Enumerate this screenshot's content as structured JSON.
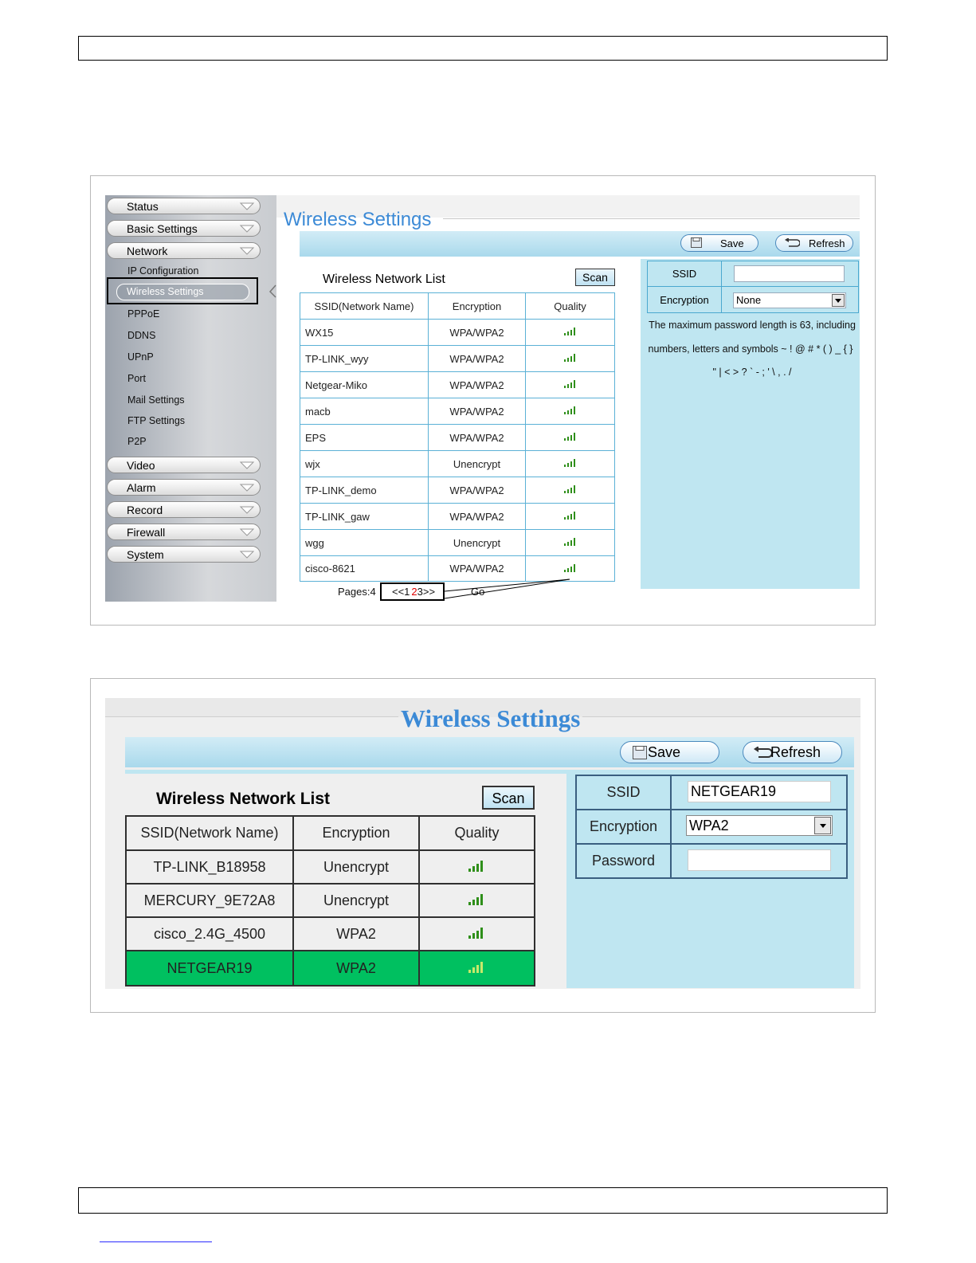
{
  "panel1": {
    "sidebar": {
      "menus_top": [
        {
          "label": "Status"
        },
        {
          "label": "Basic Settings"
        },
        {
          "label": "Network"
        }
      ],
      "network_items": [
        {
          "label": "IP Configuration"
        },
        {
          "label": "Wireless Settings"
        },
        {
          "label": "PPPoE"
        },
        {
          "label": "DDNS"
        },
        {
          "label": "UPnP"
        },
        {
          "label": "Port"
        },
        {
          "label": "Mail Settings"
        },
        {
          "label": "FTP Settings"
        },
        {
          "label": "P2P"
        }
      ],
      "menus_bottom": [
        {
          "label": "Video"
        },
        {
          "label": "Alarm"
        },
        {
          "label": "Record"
        },
        {
          "label": "Firewall"
        },
        {
          "label": "System"
        }
      ]
    },
    "title": "Wireless Settings",
    "toolbar": {
      "save_label": "Save",
      "refresh_label": "Refresh"
    },
    "list_title": "Wireless Network List",
    "scan_label": "Scan",
    "columns": [
      "SSID(Network Name)",
      "Encryption",
      "Quality"
    ],
    "rows": [
      {
        "ssid": "WX15",
        "encryption": "WPA/WPA2"
      },
      {
        "ssid": "TP-LINK_wyy",
        "encryption": "WPA/WPA2"
      },
      {
        "ssid": "Netgear-Miko",
        "encryption": "WPA/WPA2"
      },
      {
        "ssid": "macb",
        "encryption": "WPA/WPA2"
      },
      {
        "ssid": "EPS",
        "encryption": "WPA/WPA2"
      },
      {
        "ssid": "wjx",
        "encryption": "Unencrypt"
      },
      {
        "ssid": "TP-LINK_demo",
        "encryption": "WPA/WPA2"
      },
      {
        "ssid": "TP-LINK_gaw",
        "encryption": "WPA/WPA2"
      },
      {
        "ssid": "wgg",
        "encryption": "Unencrypt"
      },
      {
        "ssid": "cisco-8621",
        "encryption": "WPA/WPA2"
      }
    ],
    "pagination": {
      "pages_label": "Pages:4",
      "prev": "<<1",
      "current": "2",
      "next": "3>>",
      "go": "Go"
    },
    "form": {
      "ssid_label": "SSID",
      "ssid_value": "",
      "encryption_label": "Encryption",
      "encryption_value": "None"
    },
    "note_lines": [
      "The maximum password length is 63, including",
      "numbers, letters and symbols ~ ! @ # * ( ) _ { }",
      "\" | < > ? ` - ; ' \\ , . /"
    ]
  },
  "panel2": {
    "title": "Wireless Settings",
    "toolbar": {
      "save_label": "Save",
      "refresh_label": "Refresh"
    },
    "list_title": "Wireless Network List",
    "scan_label": "Scan",
    "columns": [
      "SSID(Network Name)",
      "Encryption",
      "Quality"
    ],
    "rows": [
      {
        "ssid": "TP-LINK_B18958",
        "encryption": "Unencrypt",
        "selected": false
      },
      {
        "ssid": "MERCURY_9E72A8",
        "encryption": "Unencrypt",
        "selected": false
      },
      {
        "ssid": "cisco_2.4G_4500",
        "encryption": "WPA2",
        "selected": false
      },
      {
        "ssid": "NETGEAR19",
        "encryption": "WPA2",
        "selected": true
      }
    ],
    "form": {
      "ssid_label": "SSID",
      "ssid_value": "NETGEAR19",
      "encryption_label": "Encryption",
      "encryption_value": "WPA2",
      "password_label": "Password",
      "password_value": ""
    }
  },
  "colors": {
    "title_blue": "#3c8ad6",
    "selected_row": "#00c060",
    "signal_green": "#2f8f1a"
  }
}
